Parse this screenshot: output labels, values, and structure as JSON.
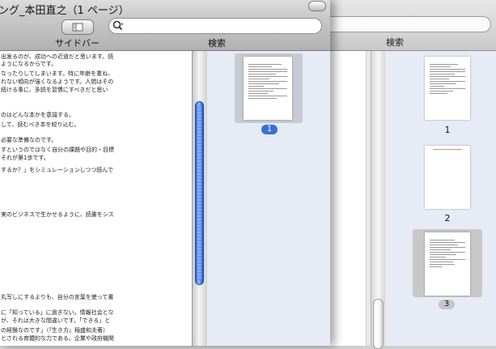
{
  "front_window": {
    "title": "ング_本田直之（1 ページ）",
    "toolbar": {
      "sidebar_label": "サイドバー",
      "search_label": "検索",
      "search_value": ""
    },
    "document_lines": [
      "出发るのが、成功への近道だと思います。読",
      "ようになるからです。",
      "なったりしてしまいます。特に年齢を重ね、",
      "れない傾向が強くなるようです。人間はその",
      "続ける事に、多読を習慣にすべきだと思い",
      "",
      "",
      "",
      "のはどんな本かを意識する。",
      "して、読むべき本を絞り込む。",
      "",
      "必要な準備なのです。",
      "すというのではなく自分の課題や目的・目標",
      "それが第1歩です。",
      "するか？」をシミュレーションしつつ読んで",
      "",
      "",
      "",
      "",
      "",
      "実のビジネスで生かせるように、読書をシス",
      "",
      "",
      "",
      "",
      "",
      "",
      "",
      "",
      "",
      "",
      "",
      "",
      "",
      "丸写しにするよりも、自分の言葉を使って書",
      "",
      "に「知っている」に過ぎない。情報社会とな",
      "が、それは大きな間違いです。「できる」と",
      "の経験なのです」（『生き方』稲盛和夫著）",
      "とされる育體的な力である。企業や政府機関"
    ],
    "selected_page_badge": "1"
  },
  "back_window": {
    "search_label": "検索",
    "pages": [
      {
        "number": "1"
      },
      {
        "number": "2"
      },
      {
        "number": "3"
      }
    ]
  },
  "colors": {
    "accent": "#3a6fd8",
    "sidebar_bg": "#e6ebf6",
    "toolbar_top": "#c9c9c9",
    "toolbar_bottom": "#b1b1b1"
  }
}
